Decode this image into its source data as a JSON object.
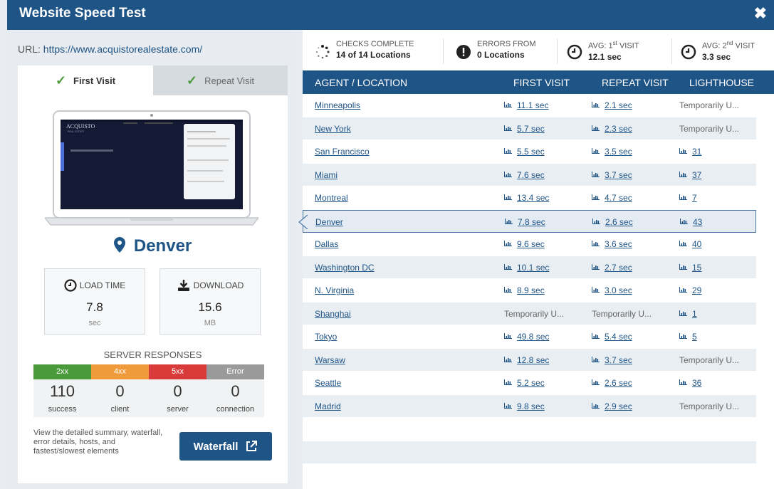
{
  "window": {
    "title": "Website Speed Test",
    "close": "✖"
  },
  "url": {
    "label": "URL:",
    "value": "https://www.acquistorealestate.com/"
  },
  "tabs": [
    {
      "label": "First Visit",
      "active": true
    },
    {
      "label": "Repeat Visit",
      "active": false
    }
  ],
  "site_preview": {
    "logo_text": "ACQUISTO",
    "logo_sub": "REAL ESTATE"
  },
  "location": "Denver",
  "metrics": {
    "load_time": {
      "label": "LOAD TIME",
      "value": "7.8",
      "unit": "sec"
    },
    "download": {
      "label": "DOWNLOAD",
      "value": "15.6",
      "unit": "MB"
    }
  },
  "server_responses": {
    "title": "SERVER RESPONSES",
    "items": [
      {
        "code": "2xx",
        "count": "110",
        "desc": "success",
        "color": "#4a9a3c"
      },
      {
        "code": "4xx",
        "count": "0",
        "desc": "client",
        "color": "#f09a3c"
      },
      {
        "code": "5xx",
        "count": "0",
        "desc": "server",
        "color": "#d93a3a"
      },
      {
        "code": "Error",
        "count": "0",
        "desc": "connection",
        "color": "#9a9a9a"
      }
    ]
  },
  "waterfall": {
    "text": "View the detailed summary, waterfall, error details, hosts, and fastest/slowest elements",
    "button": "Waterfall"
  },
  "stats": {
    "checks": {
      "label": "CHECKS COMPLETE",
      "value": "14 of 14 Locations"
    },
    "errors": {
      "label": "ERRORS FROM",
      "value": "0 Locations"
    },
    "avg1": {
      "label_pre": "AVG: 1",
      "label_sup": "st",
      "label_post": " VISIT",
      "value": "12.1 sec"
    },
    "avg2": {
      "label_pre": "AVG: 2",
      "label_sup": "nd",
      "label_post": " VISIT",
      "value": "3.3 sec"
    }
  },
  "table": {
    "headers": [
      "AGENT / LOCATION",
      "FIRST VISIT",
      "REPEAT VISIT",
      "LIGHTHOUSE"
    ],
    "rows": [
      {
        "loc": "Minneapolis",
        "fv": "11.1 sec",
        "rv": "2.1 sec",
        "lh": "Temporarily U..."
      },
      {
        "loc": "New York",
        "fv": "5.7 sec",
        "rv": "2.3 sec",
        "lh": "Temporarily U..."
      },
      {
        "loc": "San Francisco",
        "fv": "5.5 sec",
        "rv": "3.5 sec",
        "lh": "31"
      },
      {
        "loc": "Miami",
        "fv": "7.6 sec",
        "rv": "3.7 sec",
        "lh": "37"
      },
      {
        "loc": "Montreal",
        "fv": "13.4 sec",
        "rv": "4.7 sec",
        "lh": "7"
      },
      {
        "loc": "Denver",
        "fv": "7.8 sec",
        "rv": "2.6 sec",
        "lh": "43",
        "selected": true
      },
      {
        "loc": "Dallas",
        "fv": "9.6 sec",
        "rv": "3.6 sec",
        "lh": "40"
      },
      {
        "loc": "Washington DC",
        "fv": "10.1 sec",
        "rv": "2.7 sec",
        "lh": "15"
      },
      {
        "loc": "N. Virginia",
        "fv": "8.9 sec",
        "rv": "3.0 sec",
        "lh": "29"
      },
      {
        "loc": "Shanghai",
        "fv": "Temporarily U...",
        "rv": "Temporarily U...",
        "lh": "1"
      },
      {
        "loc": "Tokyo",
        "fv": "49.8 sec",
        "rv": "5.4 sec",
        "lh": "5"
      },
      {
        "loc": "Warsaw",
        "fv": "12.8 sec",
        "rv": "3.7 sec",
        "lh": "Temporarily U..."
      },
      {
        "loc": "Seattle",
        "fv": "5.2 sec",
        "rv": "2.6 sec",
        "lh": "36"
      },
      {
        "loc": "Madrid",
        "fv": "9.8 sec",
        "rv": "2.9 sec",
        "lh": "Temporarily U..."
      }
    ]
  },
  "colors": {
    "brand": "#1f5486",
    "row_alt": "#e9eef3",
    "check_green": "#4a9a3c"
  }
}
